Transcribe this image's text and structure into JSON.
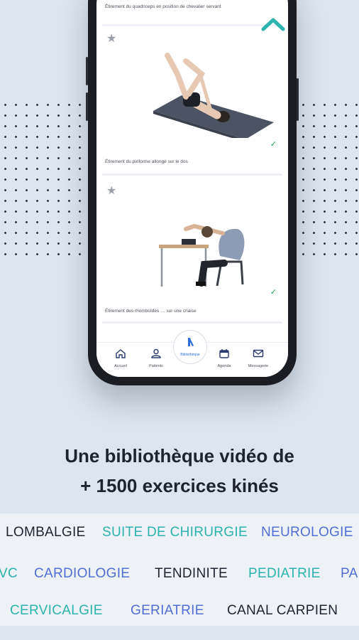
{
  "exercises": [
    {
      "title": "Étirement du quadriceps en position de chevalier servant",
      "done": "✓"
    },
    {
      "title": "Étirement du piriforme allongé sur le dos",
      "done": "✓",
      "star": "★"
    },
    {
      "title": "Étirement des rhomboïdes … sur une chaise",
      "done": "✓",
      "star": "★"
    }
  ],
  "nav": {
    "accueil": "Accueil",
    "patients": "Patients",
    "bibliotheque": "Bibliothèque",
    "agenda": "Agenda",
    "messagerie": "Messagerie"
  },
  "headline": {
    "line1": "Une bibliothèque vidéo de",
    "line2": "+ 1500 exercices kinés"
  },
  "tags": {
    "row1": [
      {
        "text": "LOMBALGIE",
        "color": "#1e2330"
      },
      {
        "text": "SUITE DE CHIRURGIE",
        "color": "#2bb3ad"
      },
      {
        "text": "NEUROLOGIE",
        "color": "#4f6fd6"
      }
    ],
    "row2": [
      {
        "text": "VC",
        "color": "#2bb3ad"
      },
      {
        "text": "CARDIOLOGIE",
        "color": "#4f6fd6"
      },
      {
        "text": "TENDINITE",
        "color": "#1e2330"
      },
      {
        "text": "PEDIATRIE",
        "color": "#2bb3ad"
      },
      {
        "text": "PA",
        "color": "#4f6fd6"
      }
    ],
    "row3": [
      {
        "text": "CERVICALGIE",
        "color": "#2bb3ad"
      },
      {
        "text": "GERIATRIE",
        "color": "#4f6fd6"
      },
      {
        "text": "CANAL CARPIEN",
        "color": "#1e2330"
      }
    ]
  },
  "colors": {
    "accent_teal": "#2bb3ad",
    "accent_blue": "#4f6fd6",
    "check_green": "#22a35a",
    "background": "#dde5ee"
  }
}
